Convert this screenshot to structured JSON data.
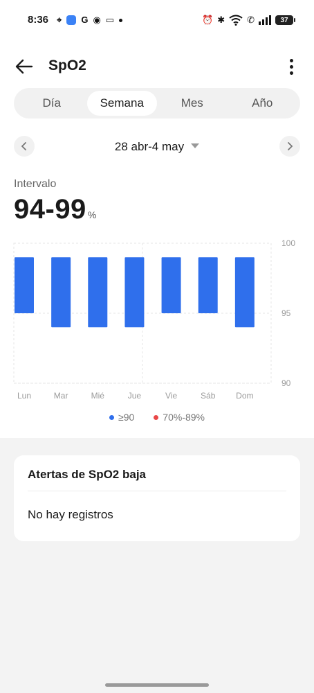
{
  "status_bar": {
    "time": "8:36",
    "battery": "37"
  },
  "header": {
    "title": "SpO2"
  },
  "tabs": [
    {
      "label": "Día",
      "active": false
    },
    {
      "label": "Semana",
      "active": true
    },
    {
      "label": "Mes",
      "active": false
    },
    {
      "label": "Año",
      "active": false
    }
  ],
  "date_nav": {
    "range": "28 abr-4 may"
  },
  "summary": {
    "label": "Intervalo",
    "value": "94-99",
    "unit": "%"
  },
  "colors": {
    "accent": "#2f6fec",
    "low": "#e94848"
  },
  "chart_data": {
    "type": "bar",
    "categories": [
      "Lun",
      "Mar",
      "Mié",
      "Jue",
      "Vie",
      "Sáb",
      "Dom"
    ],
    "series": [
      {
        "name": "≥90",
        "ranges": [
          [
            95,
            99
          ],
          [
            94,
            99
          ],
          [
            94,
            99
          ],
          [
            94,
            99
          ],
          [
            95,
            99
          ],
          [
            95,
            99
          ],
          [
            94,
            99
          ]
        ]
      }
    ],
    "yticks": [
      100,
      95,
      90
    ],
    "ylim": [
      90,
      100
    ],
    "legend": [
      {
        "label": "≥90",
        "color": "#2f6fec"
      },
      {
        "label": "70%-89%",
        "color": "#e94848"
      }
    ]
  },
  "alerts": {
    "title": "Atertas de SpO2 baja",
    "empty_text": "No hay registros"
  }
}
